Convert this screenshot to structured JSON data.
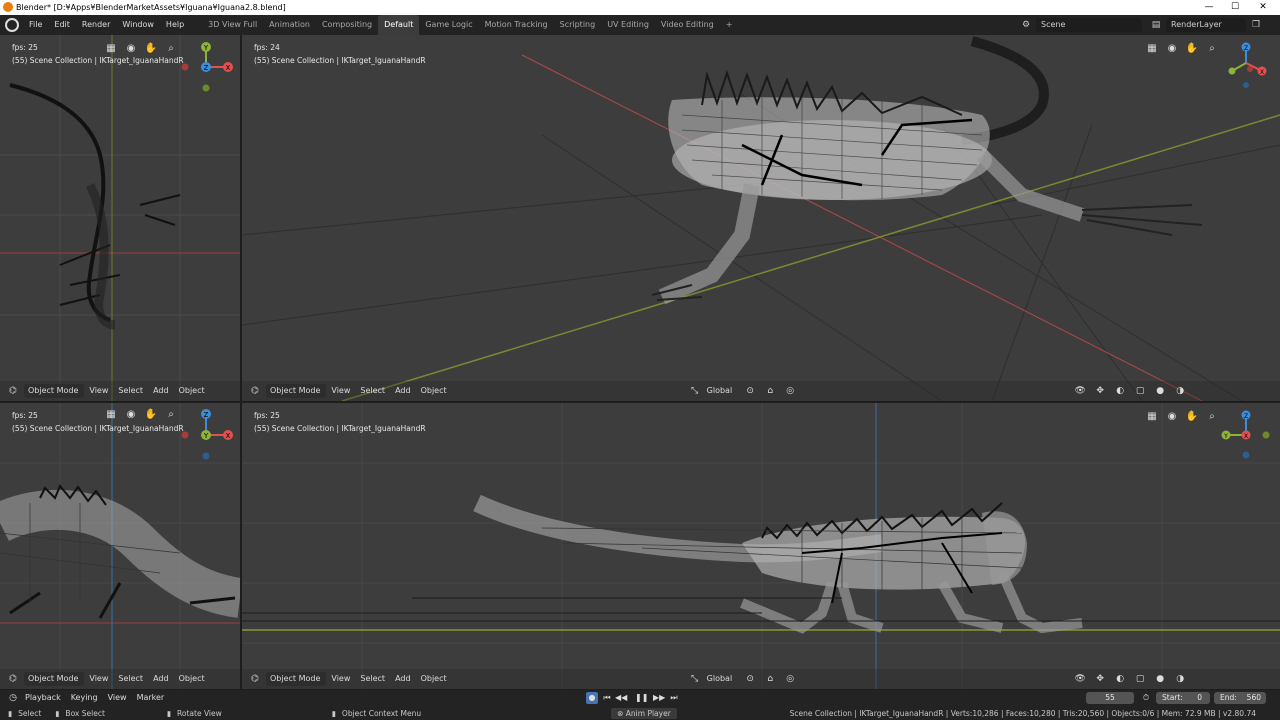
{
  "window": {
    "title": "Blender* [D:¥Apps¥BlenderMarketAssets¥Iguana¥Iguana2.8.blend]",
    "minimize": "—",
    "maximize": "☐",
    "close": "✕"
  },
  "menu": [
    "File",
    "Edit",
    "Render",
    "Window",
    "Help"
  ],
  "workspaces": {
    "tabs": [
      "3D View Full",
      "Animation",
      "Compositing",
      "Default",
      "Game Logic",
      "Motion Tracking",
      "Scripting",
      "UV Editing",
      "Video Editing"
    ],
    "active": "Default",
    "add": "+"
  },
  "scene": "Scene",
  "render_layer": "RenderLayer",
  "viewports": {
    "top_left": {
      "fps": "fps: 25",
      "collection": "(55) Scene Collection | IKTarget_IguanaHandR"
    },
    "top_right": {
      "fps": "fps: 24",
      "collection": "(55) Scene Collection | IKTarget_IguanaHandR"
    },
    "bottom_left": {
      "fps": "fps: 25",
      "collection": "(55) Scene Collection | IKTarget_IguanaHandR"
    },
    "bottom_right": {
      "fps": "fps: 25",
      "collection": "(55) Scene Collection | IKTarget_IguanaHandR"
    }
  },
  "viewport_header": {
    "mode": "Object Mode",
    "menus": [
      "View",
      "Select",
      "Add",
      "Object"
    ],
    "orientation": "Global"
  },
  "gizmo": {
    "x": "X",
    "y": "Y",
    "z": "Z"
  },
  "timeline": {
    "menus": [
      "Playback",
      "Keying",
      "View",
      "Marker"
    ],
    "current_frame": "55",
    "start_label": "Start:",
    "start": "0",
    "end_label": "End:",
    "end": "560"
  },
  "status": {
    "select": "Select",
    "box_select": "Box Select",
    "rotate": "Rotate View",
    "context": "Object Context Menu",
    "anim_player": "Anim Player",
    "info": "Scene Collection | IKTarget_IguanaHandR | Verts:10,286 | Faces:10,280 | Tris:20,560 | Objects:0/6 | Mem: 72.9 MB | v2.80.74"
  },
  "colors": {
    "viewport_bg": "#3d3d3d",
    "axis_red": "#e05252",
    "axis_green": "#8db33a",
    "axis_blue": "#3b8fd9",
    "accent": "#4772b3"
  },
  "icons": [
    "blender-icon",
    "grid-icon",
    "camera-icon",
    "hand-icon",
    "zoom-icon",
    "cursor-icon",
    "transform-icon",
    "pivot-icon",
    "snap-icon",
    "proportional-icon",
    "overlay-icon",
    "shading-icon",
    "record-icon",
    "jump-start-icon",
    "play-icon",
    "jump-end-icon"
  ]
}
